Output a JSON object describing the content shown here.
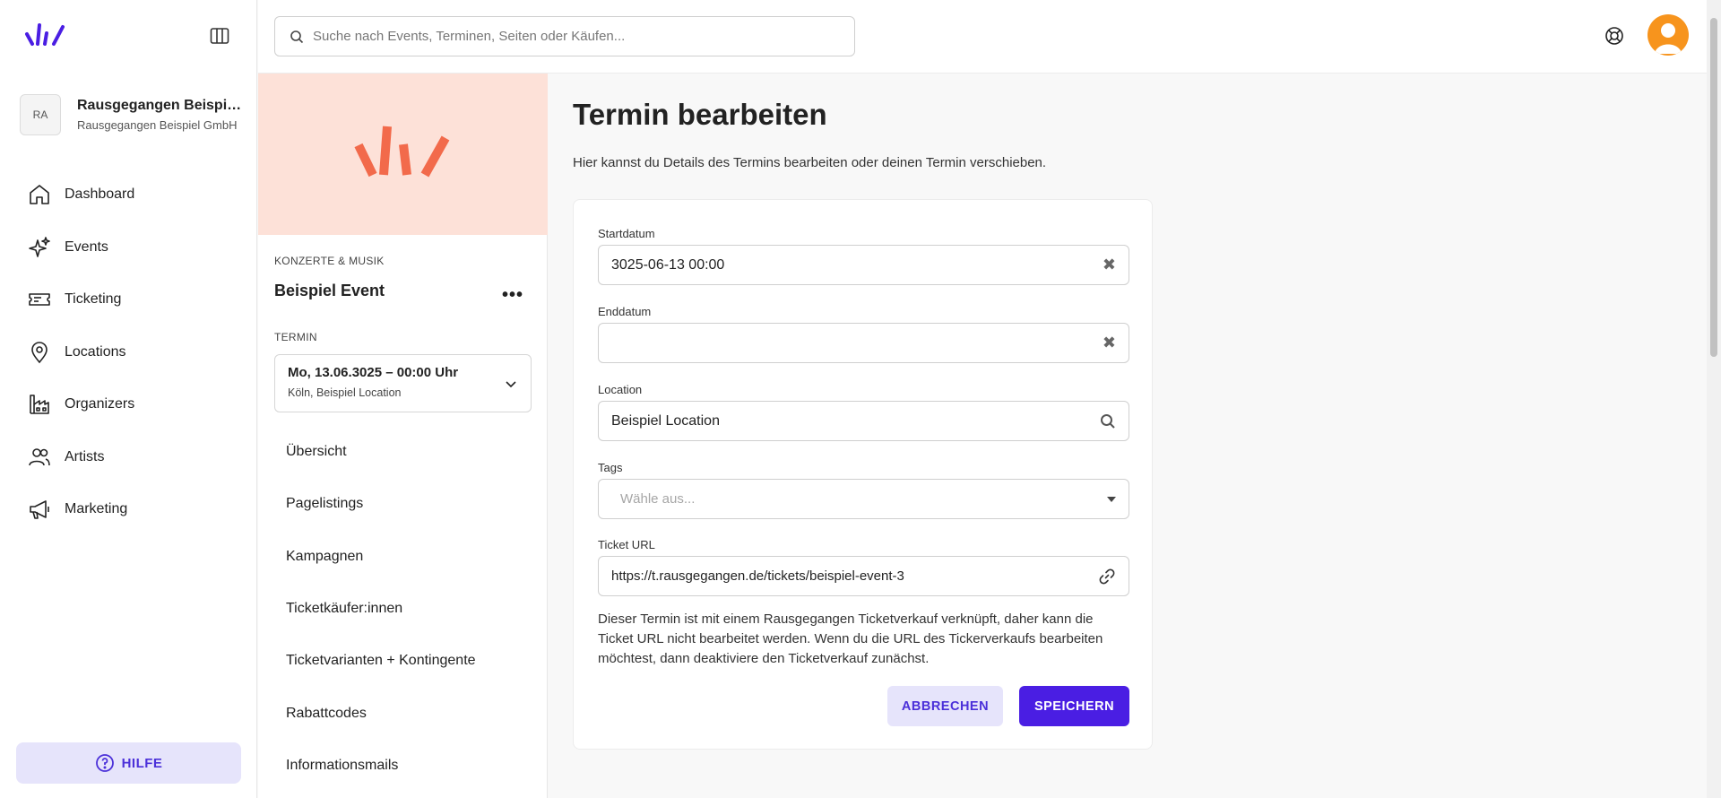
{
  "search": {
    "placeholder": "Suche nach Events, Terminen, Seiten oder Käufen..."
  },
  "org": {
    "initials": "RA",
    "name": "Rausgegangen Beispiel...",
    "company": "Rausgegangen Beispiel GmbH"
  },
  "nav": {
    "items": [
      {
        "label": "Dashboard",
        "icon": "home-icon"
      },
      {
        "label": "Events",
        "icon": "sparkles-icon"
      },
      {
        "label": "Ticketing",
        "icon": "ticket-icon"
      },
      {
        "label": "Locations",
        "icon": "map-pin-icon"
      },
      {
        "label": "Organizers",
        "icon": "building-icon"
      },
      {
        "label": "Artists",
        "icon": "users-icon"
      },
      {
        "label": "Marketing",
        "icon": "megaphone-icon"
      }
    ]
  },
  "help": {
    "label": "HILFE"
  },
  "event": {
    "category": "KONZERTE & MUSIK",
    "name": "Beispiel Event",
    "termin_label": "TERMIN",
    "termin_main": "Mo, 13.06.3025 – 00:00 Uhr",
    "termin_sub": "Köln, Beispiel Location",
    "menu": [
      "Übersicht",
      "Pagelistings",
      "Kampagnen",
      "Ticketkäufer:innen",
      "Ticketvarianten + Kontingente",
      "Rabattcodes",
      "Informationsmails"
    ]
  },
  "page": {
    "title": "Termin bearbeiten",
    "description": "Hier kannst du Details des Termins bearbeiten oder deinen Termin verschieben."
  },
  "form": {
    "start_label": "Startdatum",
    "start_value": "3025-06-13 00:00",
    "end_label": "Enddatum",
    "end_value": "",
    "location_label": "Location",
    "location_value": "Beispiel Location",
    "tags_label": "Tags",
    "tags_placeholder": "Wähle aus...",
    "ticket_url_label": "Ticket URL",
    "ticket_url_value": "https://t.rausgegangen.de/tickets/beispiel-event-3",
    "hint": "Dieser Termin ist mit einem Rausgegangen Ticketverkauf verknüpft, daher kann die Ticket URL nicht bearbeitet werden. Wenn du die URL des Tickerverkaufs bearbeiten möchtest, dann deaktiviere den Ticketverkauf zunächst.",
    "cancel_label": "ABBRECHEN",
    "save_label": "SPEICHERN"
  },
  "colors": {
    "accent": "#4a1ee3",
    "accent_light": "#e6e4fb",
    "brand_orange": "#f26a4b",
    "hero_bg": "#fde1d8",
    "avatar": "#f7941d"
  }
}
